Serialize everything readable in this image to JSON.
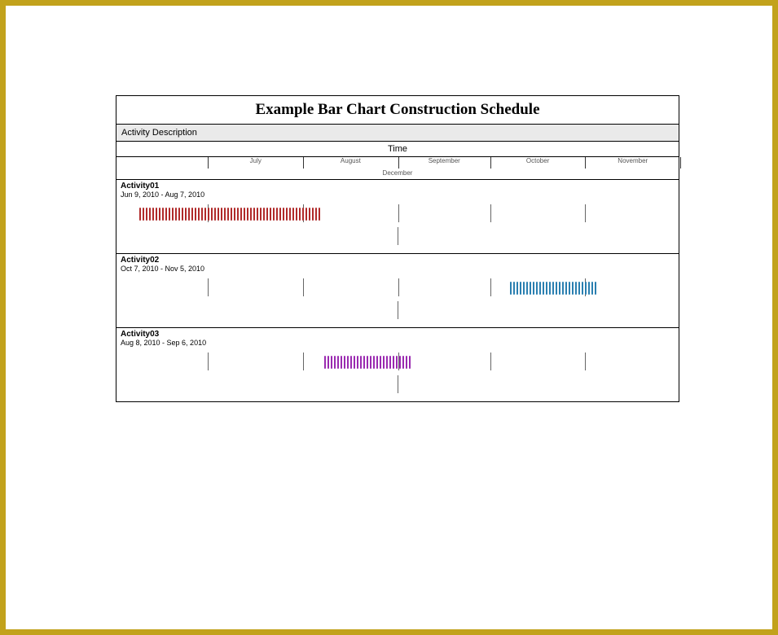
{
  "title": "Example Bar Chart Construction Schedule",
  "section_activity": "Activity Description",
  "section_time": "Time",
  "months": [
    "July",
    "August",
    "September",
    "October",
    "November"
  ],
  "month_overflow": "December",
  "timeline_start": "2010-06-01",
  "timeline_end": "2010-12-01",
  "activities": [
    {
      "name": "Activity01",
      "range": "Jun 9, 2010 - Aug 7, 2010",
      "start_pct": 4,
      "end_pct": 37,
      "color": "#b02a2a"
    },
    {
      "name": "Activity02",
      "range": "Oct 7, 2010 - Nov 5, 2010",
      "start_pct": 70,
      "end_pct": 86,
      "color": "#2a7fb0"
    },
    {
      "name": "Activity03",
      "range": "Aug 8, 2010 - Sep 6, 2010",
      "start_pct": 37,
      "end_pct": 53,
      "color": "#9a2ab0"
    }
  ],
  "month_ticks_pct": [
    16.3,
    33.2,
    50.1,
    66.5,
    83.4,
    100.3
  ],
  "mid_tick_pct": 50,
  "chart_data": {
    "type": "bar",
    "orientation": "gantt",
    "title": "Example Bar Chart Construction Schedule",
    "xlabel": "Time",
    "x_ticks": [
      "July",
      "August",
      "September",
      "October",
      "November",
      "December"
    ],
    "x_range": [
      "2010-06-01",
      "2010-12-01"
    ],
    "series": [
      {
        "name": "Activity01",
        "start": "2010-06-09",
        "end": "2010-08-07",
        "color": "#b02a2a"
      },
      {
        "name": "Activity02",
        "start": "2010-10-07",
        "end": "2010-11-05",
        "color": "#2a7fb0"
      },
      {
        "name": "Activity03",
        "start": "2010-08-08",
        "end": "2010-09-06",
        "color": "#9a2ab0"
      }
    ]
  }
}
